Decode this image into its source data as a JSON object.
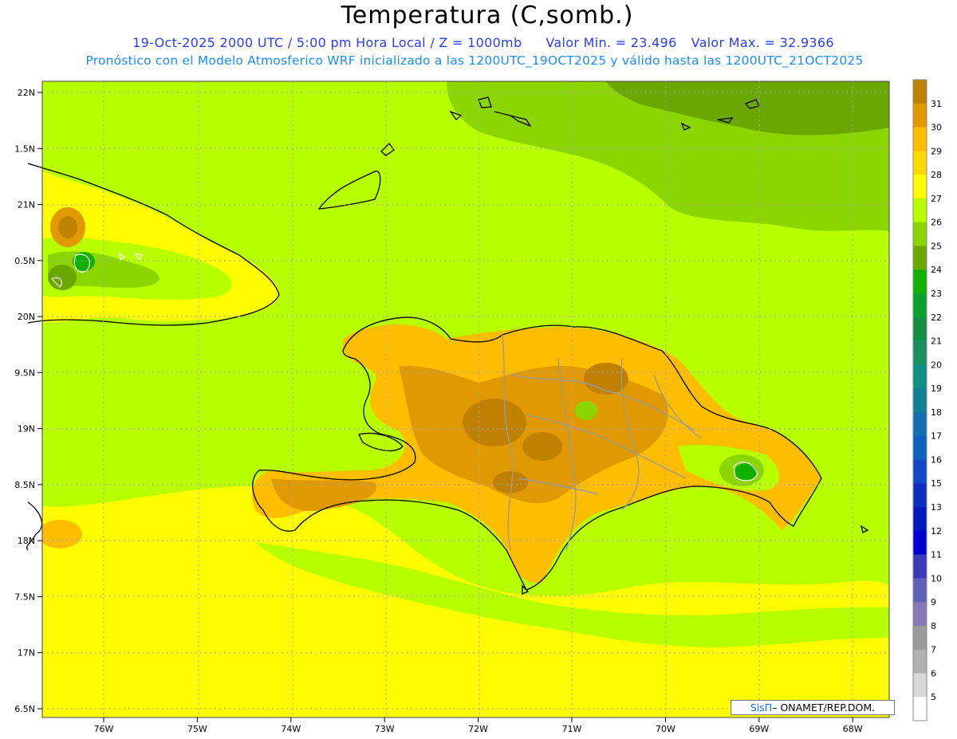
{
  "header": {
    "title": "Temperatura (C,somb.)",
    "datetime": "19-Oct-2025  2000 UTC / 5:00 pm Hora Local / Z = 1000mb",
    "min_value": "Valor Min. = 23.496",
    "max_value": "Valor Max. = 32.9366",
    "model_info": "Pronóstico con el Modelo Atmosferico WRF inicializado a las 1200UTC_19OCT2025 y válido hasta las  1200UTC_21OCT2025"
  },
  "credit": {
    "brand": "SisΠ",
    "org": "– ONAMET/REP.DOM."
  },
  "axes": {
    "lat_labels": [
      "22N",
      "1.5N",
      "21N",
      "0.5N",
      "20N",
      "9.5N",
      "19N",
      "8.5N",
      "18N",
      "7.5N",
      "17N",
      "6.5N"
    ],
    "lon_labels": [
      "76W",
      "75W",
      "74W",
      "73W",
      "72W",
      "71W",
      "70W",
      "69W",
      "68W"
    ]
  },
  "colorbar": {
    "levels": [
      "31",
      "30",
      "29",
      "28",
      "27",
      "26",
      "25",
      "24",
      "23",
      "22",
      "21",
      "20",
      "19",
      "18",
      "17",
      "16",
      "15",
      "13",
      "12",
      "11",
      "10",
      "9",
      "8",
      "7",
      "6",
      "5"
    ],
    "colors": [
      "#c08000",
      "#e09a00",
      "#ffbd00",
      "#ffd800",
      "#fffc00",
      "#b8ff00",
      "#8cd600",
      "#6aa800",
      "#10b000",
      "#0aa030",
      "#109040",
      "#1a9060",
      "#109080",
      "#108098",
      "#1070b0",
      "#1060c0",
      "#1048c8",
      "#0a30c0",
      "#0018c0",
      "#0000d0",
      "#3a3ab8",
      "#6060b8",
      "#8878b8",
      "#9a9a9a",
      "#b0b0b0",
      "#d8d8d8",
      "#ffffff"
    ]
  },
  "colors": {
    "warm": "#fffc00",
    "lime": "#b8ff00",
    "green": "#8cd600",
    "dark_green": "#6aa800",
    "orange": "#ffbd00",
    "dark_orange": "#e09a00",
    "brown": "#c08000"
  }
}
